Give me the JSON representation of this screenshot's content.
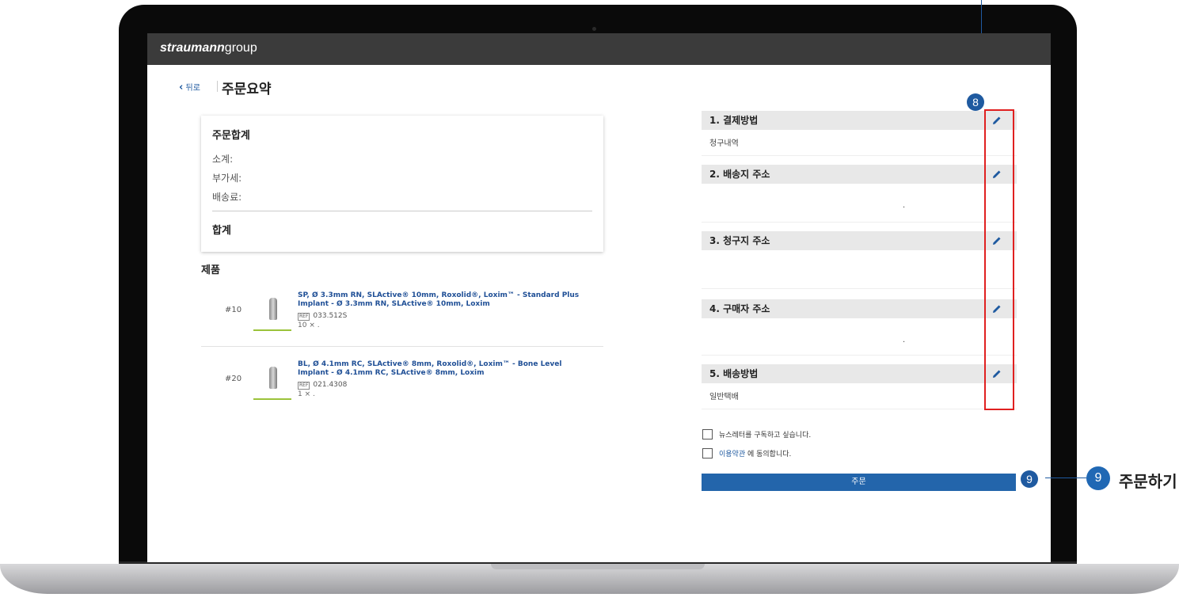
{
  "brand": {
    "bold": "straumann",
    "light": "group"
  },
  "header": {
    "back_label": "뒤로",
    "page_title": "주문요약"
  },
  "summary": {
    "title": "주문합계",
    "rows": [
      "소계:",
      "부가세:",
      "배송료:"
    ],
    "total_label": "합계"
  },
  "products": {
    "title": "제품",
    "items": [
      {
        "num": "#10",
        "name": "SP, Ø 3.3mm RN, SLActive® 10mm, Roxolid®, Loxim™ - Standard Plus Implant - Ø 3.3mm RN, SLActive® 10mm, Loxim",
        "ref_tag": "REF",
        "ref": "033.512S",
        "qty": "10 ×     ."
      },
      {
        "num": "#20",
        "name": "BL, Ø 4.1mm RC, SLActive® 8mm, Roxolid®, Loxim™ - Bone Level Implant - Ø 4.1mm RC, SLActive® 8mm, Loxim",
        "ref_tag": "REF",
        "ref": "021.4308",
        "qty": "1 ×     ."
      }
    ]
  },
  "sections": [
    {
      "title": "1. 결제방법",
      "value": "청구내역"
    },
    {
      "title": "2. 배송지 주소",
      "value": "."
    },
    {
      "title": "3. 청구지 주소",
      "value": ""
    },
    {
      "title": "4. 구매자 주소",
      "value": "."
    },
    {
      "title": "5. 배송방법",
      "value": "일반택배"
    }
  ],
  "checkboxes": {
    "newsletter": "뉴스레터를 구독하고 싶습니다.",
    "terms_link": "이용약관",
    "terms_suffix": " 에 동의합니다."
  },
  "order_button": "주문",
  "callouts": {
    "edit_badge": "8",
    "order_badge": "9",
    "order_text": "주문하기"
  },
  "colors": {
    "accent": "#2365ab",
    "highlight": "#e02020",
    "topbar": "#3b3b3b",
    "product_line": "#9bc33a"
  }
}
